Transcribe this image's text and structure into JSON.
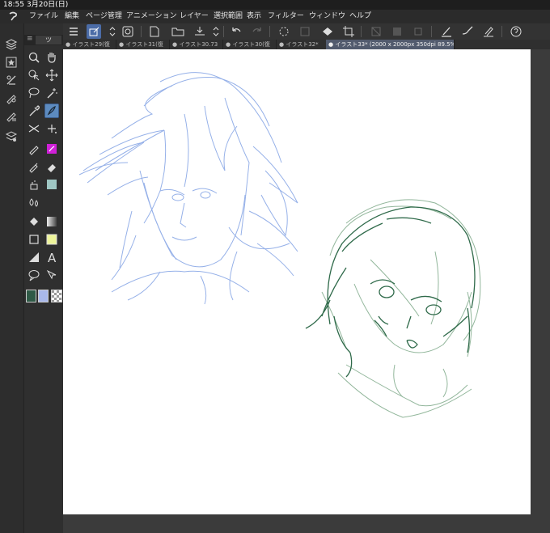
{
  "status": {
    "time": "18:55",
    "date": "3月20日(日)"
  },
  "menu": [
    {
      "id": "file",
      "label": "ファイル"
    },
    {
      "id": "edit",
      "label": "編集"
    },
    {
      "id": "page",
      "label": "ページ管理"
    },
    {
      "id": "anim",
      "label": "アニメーション"
    },
    {
      "id": "layer",
      "label": "レイヤー"
    },
    {
      "id": "select",
      "label": "選択範囲"
    },
    {
      "id": "view",
      "label": "表示"
    },
    {
      "id": "filter",
      "label": "フィルター"
    },
    {
      "id": "window",
      "label": "ウィンドウ"
    },
    {
      "id": "help",
      "label": "ヘルプ"
    }
  ],
  "tabs": [
    {
      "label": "● イラスト29(復"
    },
    {
      "label": "● イラスト31(復"
    },
    {
      "label": "● イラスト30.73"
    },
    {
      "label": "● イラスト30(復"
    },
    {
      "label": "● イラスト32*"
    },
    {
      "label": "● イラスト33* (2000 x 2000px 350dpi 89.5%)"
    }
  ],
  "panel": {
    "tab_label": "ツ"
  },
  "colors": {
    "accent": "#4b6ca7",
    "sketch_blue": "#8aa8e6",
    "sketch_green": "#2f6a4a",
    "sketch_green_light": "#7faa8a",
    "main_color": "#2f5a46",
    "sub_color": "#a9b8ea"
  }
}
